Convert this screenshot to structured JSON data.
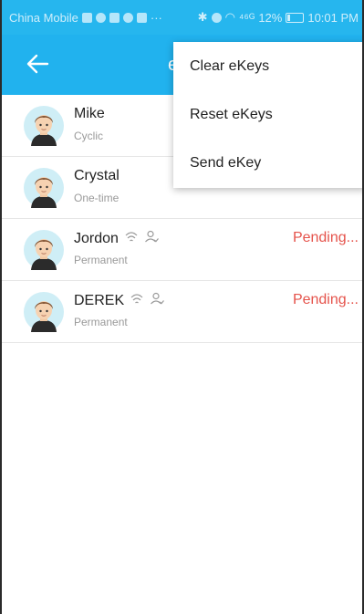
{
  "status_bar": {
    "carrier": "China Mobile",
    "signal": "⁴⁶ᴳ",
    "battery": "12%",
    "time": "10:01 PM"
  },
  "app_bar": {
    "title_partial": "e",
    "back_icon": "arrow-left-icon"
  },
  "menu": {
    "items": [
      {
        "label": "Clear eKeys"
      },
      {
        "label": "Reset eKeys"
      },
      {
        "label": "Send eKey"
      }
    ]
  },
  "users": [
    {
      "name": "Mike",
      "type": "Cyclic",
      "status": ""
    },
    {
      "name": "Crystal",
      "type": "One-time",
      "status": ""
    },
    {
      "name": "Jordon",
      "type": "Permanent",
      "status": "Pending..."
    },
    {
      "name": "DEREK",
      "type": "Permanent",
      "status": "Pending..."
    }
  ],
  "colors": {
    "primary": "#21b2ee",
    "pending": "#e5534b"
  }
}
